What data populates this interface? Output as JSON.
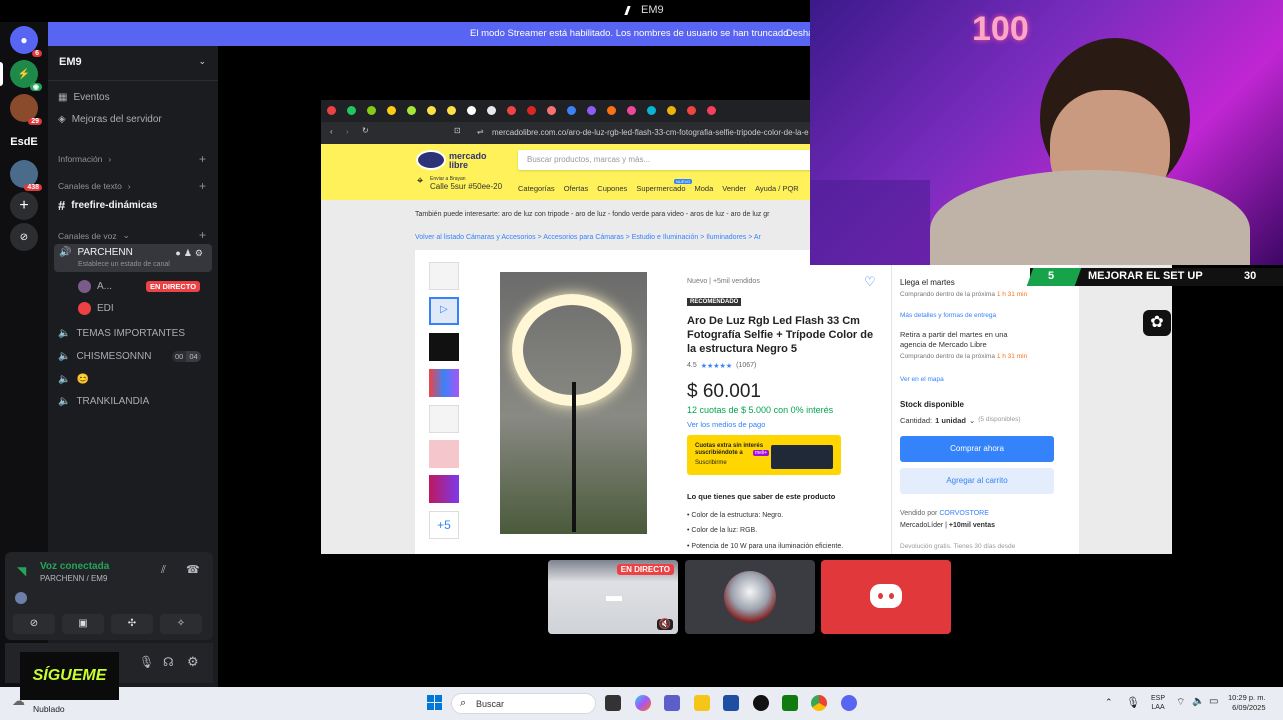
{
  "titlebar": {
    "title": "EM9"
  },
  "banner": {
    "text": "El modo Streamer está habilitado. Los nombres de usuario se han truncado.",
    "action": "Desha"
  },
  "rail": {
    "servers": [
      {
        "label": "",
        "badge": "6",
        "color": "#5865f2"
      },
      {
        "label": "",
        "badge": "",
        "color": "#2b2d31"
      },
      {
        "label": "",
        "badge": "29",
        "color": "#8a4b2c"
      },
      {
        "label": "EsdE",
        "badge": "",
        "color": "#0f0f12"
      },
      {
        "label": "",
        "badge": "438",
        "color": "#4a6c8a"
      }
    ]
  },
  "channels": {
    "server_name": "EM9",
    "events": "Eventos",
    "boosts": "Mejoras del servidor",
    "cat_info": "Información",
    "cat_text": "Canales de texto",
    "text_channel": "freefire-dinámicas",
    "cat_voice": "Canales de voz",
    "voice_active": "PARCHENN",
    "voice_status_hint": "Establece un estado de canal",
    "member_1": "A...",
    "live_badge": "EN DIRECTO",
    "member_2": "EDI",
    "voice_2": "TEMAS IMPORTANTES",
    "voice_3": "CHISMESONNN",
    "voice_3_count_a": "00",
    "voice_3_count_b": "04",
    "voice_4": "😊",
    "voice_5": "TRANKILANDIA"
  },
  "voice": {
    "status": "Voz conectada",
    "location": "PARCHENN / EM9"
  },
  "browser": {
    "url": "mercadolibre.com.co/aro-de-luz-rgb-led-flash-33-cm-fotografia-selfie-tripode-color-de-la-e",
    "logo": "mercado libre",
    "search_placeholder": "Buscar productos, marcas y más...",
    "ship_to": "Enviar a Brayan",
    "address": "Calle 5sur #50ee-20",
    "nav": [
      "Categorías",
      "Ofertas",
      "Cupones",
      "Supermercado",
      "Moda",
      "Vender",
      "Ayuda / PQR"
    ],
    "new_tag": "NUEVO",
    "also_interest": "También puede interesarte: aro de luz con tripode - aro de luz - fondo verde para video - aros de luz - aro de luz gr",
    "crumbs": "Volver al listado   Cámaras y Accesorios > Accesorios para Cámaras > Estudio e Iluminación > Iluminadores > Ar",
    "condition": "Nuevo  |  +5mil vendidos",
    "recommended": "RECOMENDADO",
    "title": "Aro De Luz Rgb Led Flash 33 Cm Fotografía Selfie + Trípode Color de la estructura Negro 5",
    "rating": "4.5",
    "reviews": "(1067)",
    "price": "$ 60.001",
    "installments": "12 cuotas de $ 5.000 con 0% interés",
    "payment_link": "Ver los medios de pago",
    "promo_line1": "Cuotas extra sin interés",
    "promo_line2": "suscribiéndote a",
    "promo_line3": "Suscribirme",
    "promo_badge": "meli+",
    "know_title": "Lo que tienes que saber de este producto",
    "bullets": [
      "Color de la estructura: Negro.",
      "Color de la luz: RGB.",
      "Potencia de 10 W para una iluminación eficiente."
    ],
    "more_thumbs": "+5",
    "arrives": "Llega el martes",
    "arrives_sub1": "Comprando dentro de la próxima",
    "arrives_time": "1 h 31 min",
    "arrives_link": "Más detalles y formas de entrega",
    "pickup": "Retira a partir del martes en una agencia de Mercado Libre",
    "pickup_sub": "Comprando dentro de la próxima",
    "pickup_time": "1 h 31 min",
    "map_link": "Ver en el mapa",
    "stock": "Stock disponible",
    "qty_label": "Cantidad:",
    "qty_value": "1 unidad",
    "qty_avail": "(5 disponibles)",
    "buy": "Comprar ahora",
    "add_cart": "Agregar al carrito",
    "sold_by": "Vendido por",
    "seller": "CORVOSTORE",
    "seller_tag": "MercadoLíder",
    "seller_sales": "+10mil ventas",
    "return": "Devolución gratis. Tienes 30 días desde"
  },
  "webcam": {
    "balloon": "100"
  },
  "setup_bar": {
    "left": "5",
    "text": "MEJORAR EL SET UP",
    "right": "30"
  },
  "tiles": {
    "live": "EN DIRECTO"
  },
  "sticker": {
    "text": "SÍGUEME"
  },
  "taskbar": {
    "weather": "Nublado",
    "search": "Buscar",
    "lang1": "ESP",
    "lang2": "LAA",
    "time": "10:29 p. m.",
    "date": "6/09/2025"
  },
  "colors": {
    "discord_blurple": "#5865f2",
    "ml_yellow": "#fff159",
    "ml_blue": "#3483fa",
    "live_red": "#ed4245"
  }
}
